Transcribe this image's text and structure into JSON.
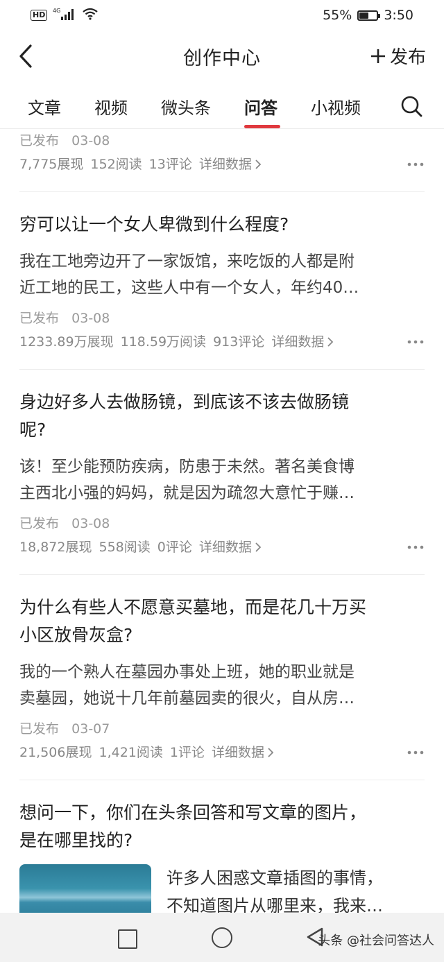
{
  "status_bar": {
    "hd": "HD",
    "network": "4G",
    "battery": "55%",
    "battery_level": 0.55,
    "time": "3:50"
  },
  "header": {
    "title": "创作中心",
    "publish_label": "发布"
  },
  "tabs": [
    {
      "label": "文章"
    },
    {
      "label": "视频"
    },
    {
      "label": "微头条"
    },
    {
      "label": "问答",
      "active": true
    },
    {
      "label": "小视频"
    }
  ],
  "items": [
    {
      "status": "已发布",
      "date": "03-08",
      "views": "7,775展现",
      "reads": "152阅读",
      "comments": "13评论",
      "detail": "详细数据"
    },
    {
      "title": "穷可以让一个女人卑微到什么程度?",
      "excerpt_lines": [
        "我在工地旁边开了一家饭馆，来吃饭的人都是附",
        "近工地的民工，这些人中有一个女人，年约40…"
      ],
      "status": "已发布",
      "date": "03-08",
      "views": "1233.89万展现",
      "reads": "118.59万阅读",
      "comments": "913评论",
      "detail": "详细数据"
    },
    {
      "title_lines": [
        "身边好多人去做肠镜，到底该不该去做肠镜",
        "呢?"
      ],
      "excerpt_lines": [
        "该！至少能预防疾病，防患于未然。著名美食博",
        "主西北小强的妈妈，就是因为疏忽大意忙于赚…"
      ],
      "status": "已发布",
      "date": "03-08",
      "views": "18,872展现",
      "reads": "558阅读",
      "comments": "0评论",
      "detail": "详细数据"
    },
    {
      "title_lines": [
        "为什么有些人不愿意买墓地，而是花几十万买",
        "小区放骨灰盒?"
      ],
      "excerpt_lines": [
        "我的一个熟人在墓园办事处上班，她的职业就是",
        "卖墓园，她说十几年前墓园卖的很火，自从房…"
      ],
      "status": "已发布",
      "date": "03-07",
      "views": "21,506展现",
      "reads": "1,421阅读",
      "comments": "1评论",
      "detail": "详细数据"
    },
    {
      "title_lines": [
        "想问一下，你们在头条回答和写文章的图片，",
        "是在哪里找的?"
      ],
      "excerpt_lines": [
        "许多人困惑文章插图的事情，",
        "不知道图片从哪里来，我来…"
      ]
    }
  ],
  "watermark": "头条 @社会问答达人"
}
